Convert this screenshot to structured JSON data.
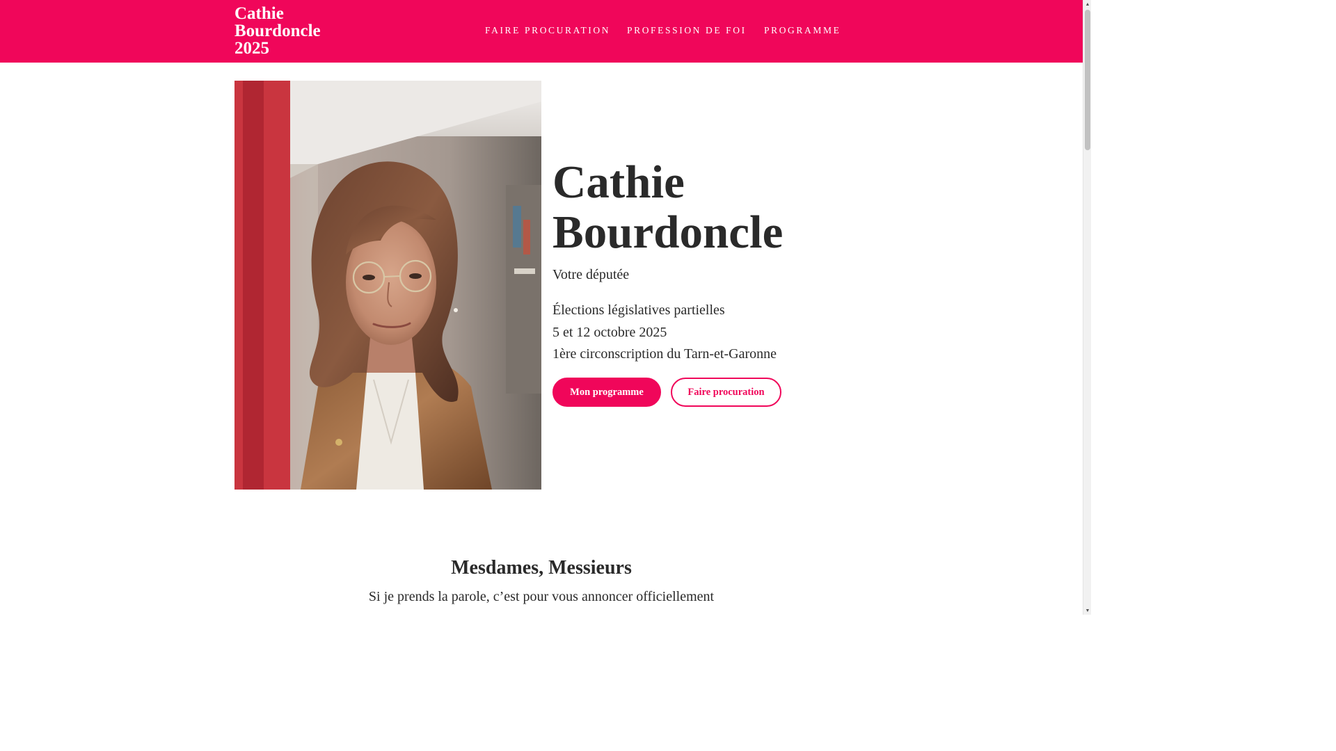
{
  "header": {
    "brand": "Cathie\nBourdoncle\n2025",
    "nav": [
      {
        "label": "FAIRE PROCURATION"
      },
      {
        "label": "PROFESSION DE FOI"
      },
      {
        "label": "PROGRAMME"
      }
    ]
  },
  "hero": {
    "name": "Cathie Bourdoncle",
    "role": "Votre députée",
    "info": [
      "Élections législatives partielles",
      "5 et 12 octobre 2025",
      "1ère circonscription du Tarn-et-Garonne"
    ],
    "buttons": {
      "primary": "Mon programme",
      "secondary": "Faire procuration"
    }
  },
  "intro": {
    "title": "Mesdames, Messieurs",
    "text": "Si je prends la parole, c’est pour vous annoncer officiellement"
  },
  "colors": {
    "accent": "#f0065a",
    "text": "#2a2a2a",
    "background": "#ffffff"
  },
  "scrollbar": {
    "up_icon": "triangle-up-icon",
    "down_icon": "triangle-down-icon"
  }
}
